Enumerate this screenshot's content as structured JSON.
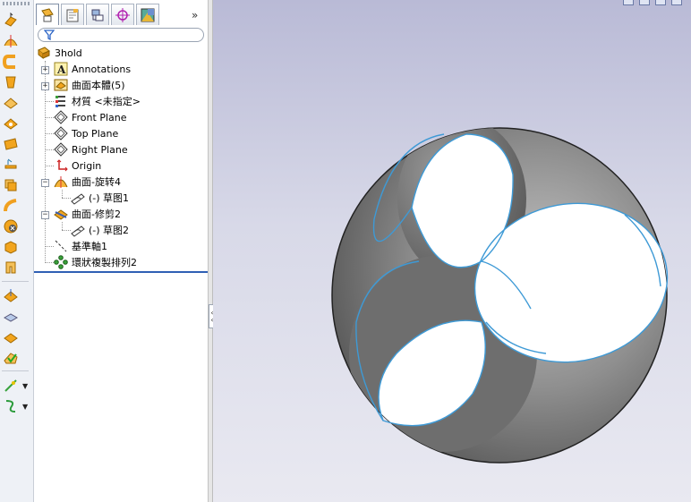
{
  "feature_tree": {
    "part_name": "3hold",
    "items": [
      {
        "label": "Annotations",
        "icon": "annotations-icon",
        "expandable": true
      },
      {
        "label": "曲面本體(5)",
        "icon": "surface-bodies-icon",
        "expandable": true
      },
      {
        "label": "材質 <未指定>",
        "icon": "material-icon",
        "expandable": false
      },
      {
        "label": "Front Plane",
        "icon": "plane-icon",
        "expandable": false
      },
      {
        "label": "Top Plane",
        "icon": "plane-icon",
        "expandable": false
      },
      {
        "label": "Right Plane",
        "icon": "plane-icon",
        "expandable": false
      },
      {
        "label": "Origin",
        "icon": "origin-icon",
        "expandable": false
      },
      {
        "label": "曲面-旋转4",
        "icon": "surface-revolve-icon",
        "expandable": true,
        "expanded": true
      },
      {
        "label": "(-) 草图1",
        "icon": "sketch-icon",
        "child": true
      },
      {
        "label": "曲面-修剪2",
        "icon": "surface-trim-icon",
        "expandable": true,
        "expanded": true
      },
      {
        "label": "(-) 草图2",
        "icon": "sketch-icon",
        "child": true
      },
      {
        "label": "基準軸1",
        "icon": "axis-icon",
        "expandable": false
      },
      {
        "label": "環狀複製排列2",
        "icon": "circular-pattern-icon",
        "expandable": false
      }
    ]
  },
  "panel_tabs": [
    "featuremanager-tab",
    "propertymanager-tab",
    "configurationmanager-tab",
    "dimxpert-tab",
    "display-manager-tab"
  ],
  "panel_more": "»",
  "toolbar_tools": [
    "extruded-surface-icon",
    "revolved-surface-icon",
    "swept-surface-icon",
    "lofted-surface-icon",
    "boundary-surface-icon",
    "filled-surface-icon",
    "planar-surface-icon",
    "offset-surface-icon",
    "ruled-surface-icon",
    "extend-surface-icon",
    "delete-face-icon",
    "untrim-surface-icon",
    "knit-surface-icon",
    "thicken-icon",
    "cut-with-surface-icon",
    "replace-face-icon",
    "move-face-icon",
    "fillet-icon",
    "mid-surface-icon",
    "curves-icon"
  ],
  "colors": {
    "selection_edge": "#3e9ad6",
    "rollback_bar": "#2f5fb4",
    "sphere_shell": "#7a7a7a",
    "sphere_hole": "#ffffff"
  }
}
